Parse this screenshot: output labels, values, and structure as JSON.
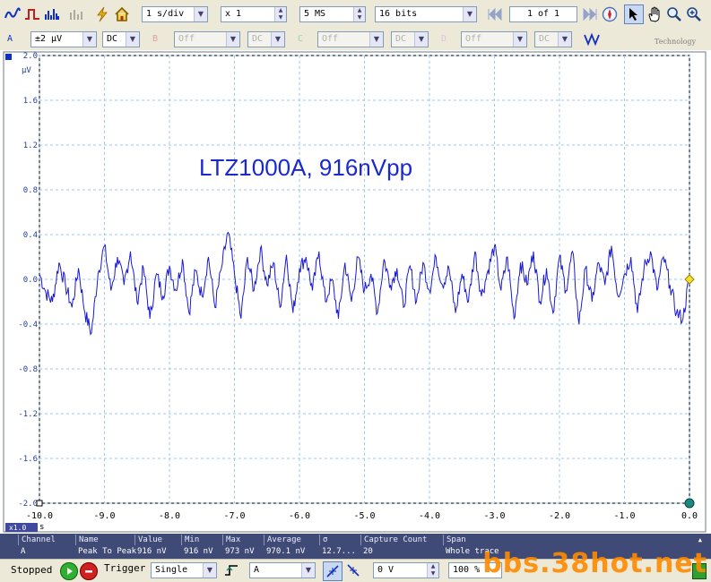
{
  "toolbar": {
    "timebase": "1 s/div",
    "zoom": "x 1",
    "samples": "5 MS",
    "resolution": "16 bits",
    "buffer": "1 of 1",
    "brand_caption": "Technology"
  },
  "channels": {
    "a_label": "A",
    "a_range": "±2 µV",
    "a_coupling": "DC",
    "b_label": "B",
    "b_range": "Off",
    "b_coupling": "DC",
    "c_label": "C",
    "c_range": "Off",
    "c_coupling": "DC",
    "d_label": "D",
    "d_range": "Off",
    "d_coupling": "DC"
  },
  "plot": {
    "annotation": "LTZ1000A, 916nVpp",
    "y_unit": "µV",
    "x_unit": "s",
    "zoom_badge": "x1.0",
    "trace_color": "#1a1ad0"
  },
  "chart_data": {
    "type": "line",
    "title": "",
    "xlabel": "s",
    "ylabel": "µV",
    "xlim": [
      -10.0,
      0.0
    ],
    "ylim": [
      -2.0,
      2.0
    ],
    "xticks": [
      "-10.0",
      "-9.0",
      "-8.0",
      "-7.0",
      "-6.0",
      "-5.0",
      "-4.0",
      "-3.0",
      "-2.0",
      "-1.0",
      "0.0"
    ],
    "yticks": [
      "2.0",
      "1.6",
      "1.2",
      "0.8",
      "0.4",
      "0.0",
      "-0.4",
      "-0.8",
      "-1.2",
      "-1.6",
      "-2.0"
    ],
    "grid": true,
    "series": [
      {
        "color": "#1a1ad0",
        "x": [
          -10.0,
          -9.9,
          -9.8,
          -9.7,
          -9.6,
          -9.5,
          -9.4,
          -9.3,
          -9.2,
          -9.1,
          -9.0,
          -8.9,
          -8.8,
          -8.7,
          -8.6,
          -8.5,
          -8.4,
          -8.3,
          -8.2,
          -8.1,
          -8.0,
          -7.9,
          -7.8,
          -7.7,
          -7.6,
          -7.5,
          -7.4,
          -7.3,
          -7.2,
          -7.1,
          -7.0,
          -6.9,
          -6.8,
          -6.7,
          -6.6,
          -6.5,
          -6.4,
          -6.3,
          -6.2,
          -6.1,
          -6.0,
          -5.9,
          -5.8,
          -5.7,
          -5.6,
          -5.5,
          -5.4,
          -5.3,
          -5.2,
          -5.1,
          -5.0,
          -4.9,
          -4.8,
          -4.7,
          -4.6,
          -4.5,
          -4.4,
          -4.3,
          -4.2,
          -4.1,
          -4.0,
          -3.9,
          -3.8,
          -3.7,
          -3.6,
          -3.5,
          -3.4,
          -3.3,
          -3.2,
          -3.1,
          -3.0,
          -2.9,
          -2.8,
          -2.7,
          -2.6,
          -2.5,
          -2.4,
          -2.3,
          -2.2,
          -2.1,
          -2.0,
          -1.9,
          -1.8,
          -1.7,
          -1.6,
          -1.5,
          -1.4,
          -1.3,
          -1.2,
          -1.1,
          -1.0,
          -0.9,
          -0.8,
          -0.7,
          -0.6,
          -0.5,
          -0.4,
          -0.3,
          -0.2,
          -0.1,
          0.0
        ],
        "y": [
          0.05,
          -0.12,
          -0.2,
          0.15,
          -0.05,
          -0.25,
          0.1,
          -0.3,
          -0.48,
          0.05,
          0.3,
          -0.1,
          0.2,
          -0.05,
          0.25,
          -0.2,
          0.1,
          -0.35,
          0.05,
          -0.15,
          0.12,
          -0.1,
          0.18,
          -0.3,
          0.08,
          -0.15,
          0.2,
          -0.25,
          0.1,
          0.42,
          0.05,
          -0.35,
          0.2,
          -0.1,
          0.28,
          -0.05,
          0.15,
          -0.25,
          0.22,
          -0.3,
          0.1,
          0.2,
          -0.1,
          0.25,
          -0.2,
          0.0,
          -0.35,
          0.15,
          -0.2,
          0.2,
          -0.1,
          0.05,
          -0.3,
          0.18,
          -0.05,
          0.1,
          -0.25,
          0.12,
          -0.2,
          0.15,
          -0.1,
          0.2,
          -0.05,
          0.1,
          -0.3,
          0.05,
          -0.2,
          0.25,
          -0.15,
          0.08,
          0.3,
          -0.1,
          0.2,
          -0.35,
          0.15,
          -0.05,
          0.25,
          -0.2,
          0.1,
          -0.3,
          0.2,
          -0.1,
          0.25,
          -0.4,
          0.1,
          -0.2,
          0.15,
          -0.05,
          0.3,
          -0.15,
          0.05,
          0.2,
          -0.3,
          0.1,
          0.25,
          -0.1,
          0.2,
          -0.05,
          -0.3,
          -0.35,
          0.02
        ]
      }
    ]
  },
  "measurements": {
    "headers": [
      "Channel",
      "Name",
      "Value",
      "Min",
      "Max",
      "Average",
      "σ",
      "Capture Count",
      "Span"
    ],
    "row": [
      "A",
      "Peak To Peak",
      "916 nV",
      "916 nV",
      "973 nV",
      "970.1 nV",
      "12.7...",
      "20",
      "Whole trace"
    ]
  },
  "status": {
    "state": "Stopped",
    "trigger_label": "Trigger",
    "trigger_mode": "Single",
    "trigger_source": "A",
    "trigger_level": "0 V",
    "percent": "100 %"
  },
  "watermark": "bbs.38hot.net",
  "colors": {
    "accent": "#1030c0",
    "grid": "#9fc7ee",
    "measure_bar": "#3f4a76",
    "watermark": "#ff8a00"
  }
}
